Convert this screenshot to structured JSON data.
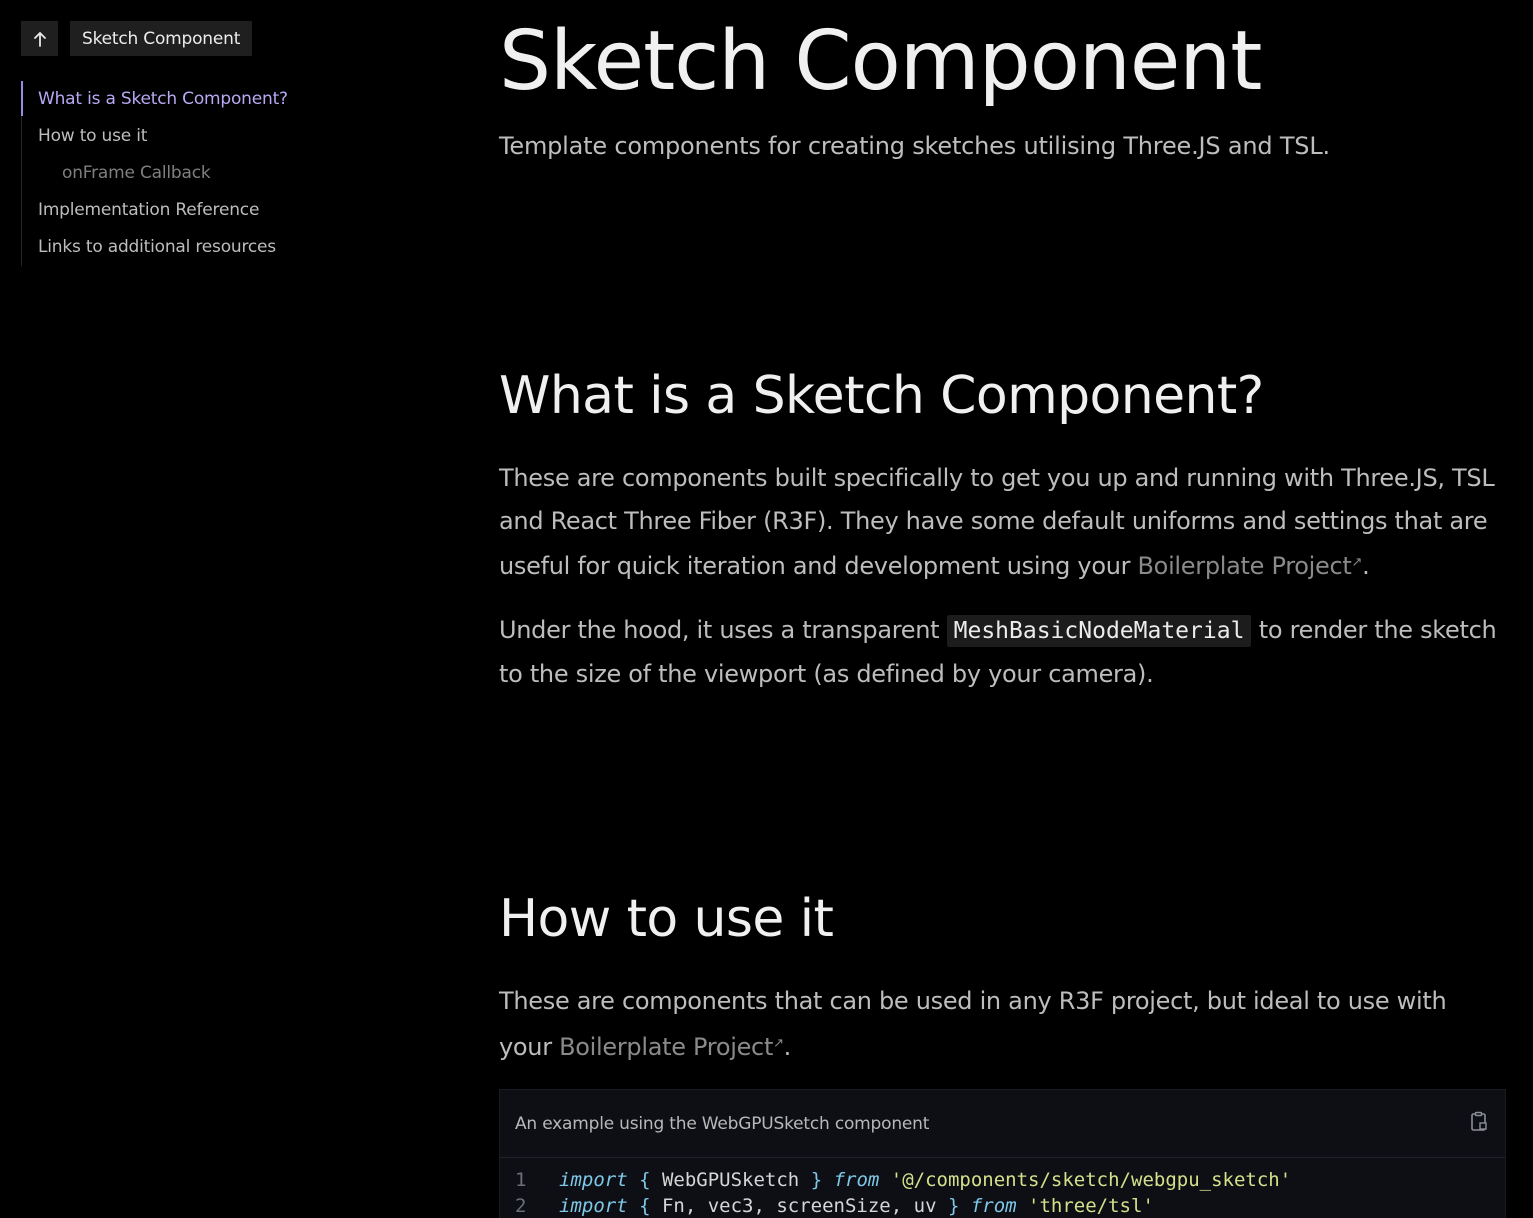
{
  "sidebar": {
    "back_button_label": "↑",
    "current_page": "Sketch Component",
    "toc": [
      {
        "label": "What is a Sketch Component?",
        "active": true,
        "level": 1
      },
      {
        "label": "How to use it",
        "active": false,
        "level": 1
      },
      {
        "label": "onFrame Callback",
        "active": false,
        "level": 2
      },
      {
        "label": "Implementation Reference",
        "active": false,
        "level": 1
      },
      {
        "label": "Links to additional resources",
        "active": false,
        "level": 1
      }
    ]
  },
  "main": {
    "title": "Sketch Component",
    "subtitle": "Template components for creating sketches utilising Three.JS and TSL.",
    "section_what": {
      "heading": "What is a Sketch Component?",
      "p1_text": "These are components built specifically to get you up and running with Three.JS, TSL and React Three Fiber (R3F). They have some default uniforms and settings that are useful for quick iteration and development using your ",
      "p1_link": "Boilerplate Project",
      "p1_end": ".",
      "p2_before": "Under the hood, it uses a transparent ",
      "p2_code": "MeshBasicNodeMaterial",
      "p2_after": " to render the sketch to the size of the viewport (as defined by your camera)."
    },
    "section_how": {
      "heading": "How to use it",
      "p1_text": "These are components that can be used in any R3F project, but ideal to use with your ",
      "p1_link": "Boilerplate Project",
      "p1_end": "."
    },
    "code_block": {
      "caption": "An example using the WebGPUSketch component",
      "copy_icon": "copy-icon",
      "lines": [
        {
          "number": "1",
          "kw1": "import",
          "open": " { ",
          "names": "WebGPUSketch",
          "close": " } ",
          "kw2": "from",
          "module": " '@/components/sketch/webgpu_sketch'"
        },
        {
          "number": "2",
          "kw1": "import",
          "open": " { ",
          "names": "Fn, vec3, screenSize, uv",
          "close": " } ",
          "kw2": "from",
          "module": " 'three/tsl'"
        }
      ]
    }
  },
  "colors": {
    "background": "#000000",
    "accent": "#b9a8f4",
    "link": "#8a8a8a",
    "code_keyword": "#7fc8e8",
    "code_string": "#d4e08a"
  }
}
